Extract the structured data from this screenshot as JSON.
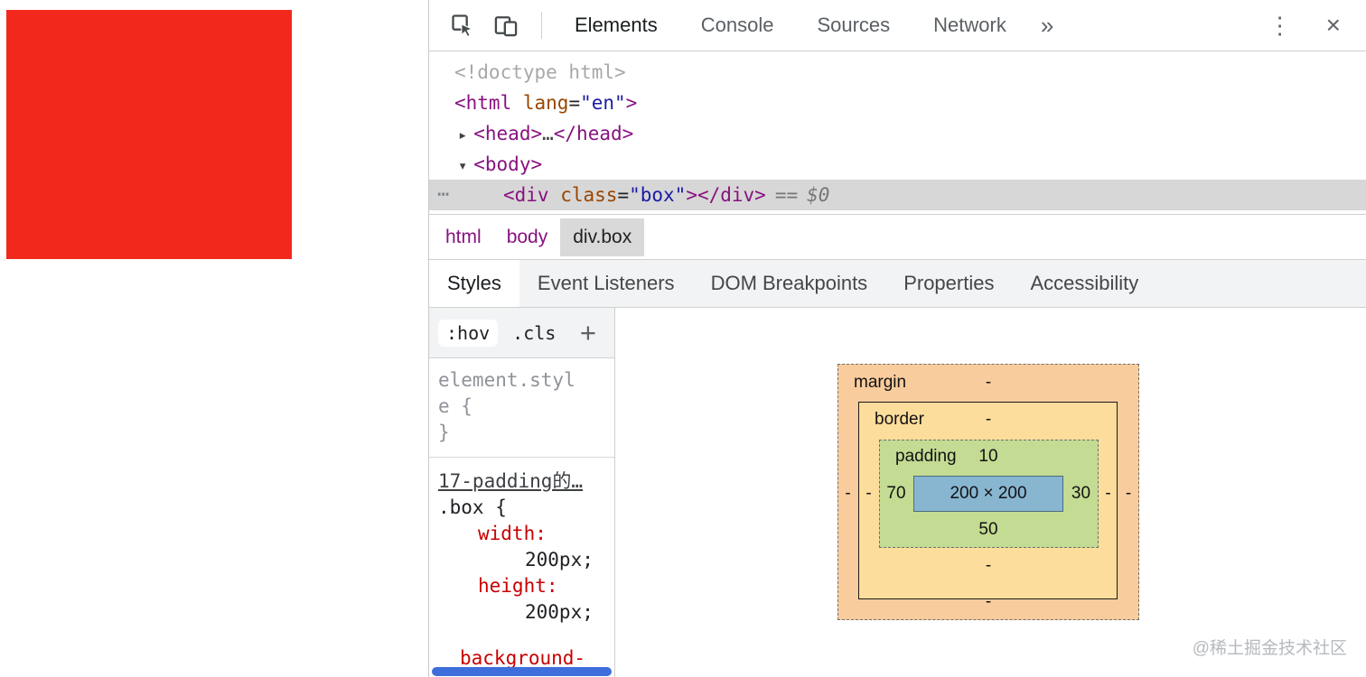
{
  "toolbar": {
    "tabs": [
      {
        "label": "Elements",
        "active": true
      },
      {
        "label": "Console",
        "active": false
      },
      {
        "label": "Sources",
        "active": false
      },
      {
        "label": "Network",
        "active": false
      }
    ],
    "more_tabs_icon": "»",
    "menu_icon": "⋮",
    "close_icon": "×"
  },
  "dom_tree": {
    "doctype": "<!doctype html>",
    "html": {
      "open": "<html ",
      "attr": "lang",
      "eq": "=",
      "value": "\"en\"",
      "close": ">"
    },
    "head": {
      "arrow": "▸",
      "open": "<head>",
      "ellipsis": "…",
      "close": "</head>"
    },
    "body": {
      "arrow": "▾",
      "open": "<body>"
    },
    "selected": {
      "dots": "⋯",
      "open": "<div ",
      "attr": "class",
      "eq": "=",
      "value": "\"box\"",
      "close": "></div>",
      "equals": "==",
      "ref": "$0"
    }
  },
  "breadcrumbs": [
    {
      "label": "html",
      "selected": false
    },
    {
      "label": "body",
      "selected": false
    },
    {
      "label": "div.box",
      "selected": true
    }
  ],
  "sidebar_tabs": [
    {
      "label": "Styles",
      "active": true
    },
    {
      "label": "Event Listeners",
      "active": false
    },
    {
      "label": "DOM Breakpoints",
      "active": false
    },
    {
      "label": "Properties",
      "active": false
    },
    {
      "label": "Accessibility",
      "active": false
    }
  ],
  "styles_pane": {
    "pseudo_toggle": ":hov",
    "class_toggle": ".cls",
    "new_rule_icon": "+",
    "element_style": {
      "header": "element.style {",
      "close": "}"
    },
    "box_rule": {
      "source_link": "17-padding的…",
      "selector": ".box {",
      "declarations": [
        {
          "property": "width:",
          "value": "200px;"
        },
        {
          "property": "height:",
          "value": "200px;"
        },
        {
          "property": "background-",
          "value": ""
        }
      ]
    }
  },
  "box_model": {
    "margin": {
      "label": "margin",
      "top": "-",
      "right": "-",
      "bottom": "-",
      "left": "-"
    },
    "border": {
      "label": "border",
      "top": "-",
      "right": "-",
      "bottom": "-",
      "left": "-"
    },
    "padding": {
      "label": "padding",
      "top": "10",
      "right": "30",
      "bottom": "50",
      "left": "70"
    },
    "content": {
      "label": "200 × 200"
    },
    "colors": {
      "margin": "#f9cc9d",
      "border": "#fddd9b",
      "padding": "#c3db92",
      "content": "#88b6d1",
      "page_box": "#f3281c"
    }
  },
  "watermark": "@稀土掘金技术社区"
}
